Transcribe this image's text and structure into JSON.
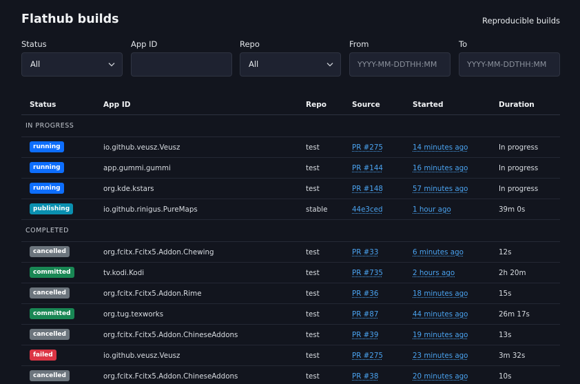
{
  "header": {
    "title": "Flathub builds",
    "top_link": "Reproducible builds"
  },
  "filters": {
    "status": {
      "label": "Status",
      "value": "All"
    },
    "app_id": {
      "label": "App ID",
      "value": ""
    },
    "repo": {
      "label": "Repo",
      "value": "All"
    },
    "from": {
      "label": "From",
      "placeholder": "YYYY-MM-DDTHH:MM"
    },
    "to": {
      "label": "To",
      "placeholder": "YYYY-MM-DDTHH:MM"
    }
  },
  "table": {
    "columns": [
      "Status",
      "App ID",
      "Repo",
      "Source",
      "Started",
      "Duration"
    ],
    "groups": [
      {
        "title": "IN PROGRESS",
        "rows": [
          {
            "status": "running",
            "app_id": "io.github.veusz.Veusz",
            "repo": "test",
            "source": "PR #275",
            "started": "14 minutes ago",
            "duration": "In progress"
          },
          {
            "status": "running",
            "app_id": "app.gummi.gummi",
            "repo": "test",
            "source": "PR #144",
            "started": "16 minutes ago",
            "duration": "In progress"
          },
          {
            "status": "running",
            "app_id": "org.kde.kstars",
            "repo": "test",
            "source": "PR #148",
            "started": "57 minutes ago",
            "duration": "In progress"
          },
          {
            "status": "publishing",
            "app_id": "io.github.rinigus.PureMaps",
            "repo": "stable",
            "source": "44e3ced",
            "started": "1 hour ago",
            "duration": "39m 0s"
          }
        ]
      },
      {
        "title": "COMPLETED",
        "rows": [
          {
            "status": "cancelled",
            "app_id": "org.fcitx.Fcitx5.Addon.Chewing",
            "repo": "test",
            "source": "PR #33",
            "started": "6 minutes ago",
            "duration": "12s"
          },
          {
            "status": "committed",
            "app_id": "tv.kodi.Kodi",
            "repo": "test",
            "source": "PR #735",
            "started": "2 hours ago",
            "duration": "2h 20m"
          },
          {
            "status": "cancelled",
            "app_id": "org.fcitx.Fcitx5.Addon.Rime",
            "repo": "test",
            "source": "PR #36",
            "started": "18 minutes ago",
            "duration": "15s"
          },
          {
            "status": "committed",
            "app_id": "org.tug.texworks",
            "repo": "test",
            "source": "PR #87",
            "started": "44 minutes ago",
            "duration": "26m 17s"
          },
          {
            "status": "cancelled",
            "app_id": "org.fcitx.Fcitx5.Addon.ChineseAddons",
            "repo": "test",
            "source": "PR #39",
            "started": "19 minutes ago",
            "duration": "13s"
          },
          {
            "status": "failed",
            "app_id": "io.github.veusz.Veusz",
            "repo": "test",
            "source": "PR #275",
            "started": "23 minutes ago",
            "duration": "3m 32s"
          },
          {
            "status": "cancelled",
            "app_id": "org.fcitx.Fcitx5.Addon.ChineseAddons",
            "repo": "test",
            "source": "PR #38",
            "started": "20 minutes ago",
            "duration": "10s"
          }
        ]
      }
    ]
  },
  "colors": {
    "background": "#12151e",
    "running": "#0d6efd",
    "publishing": "#0a90b0",
    "cancelled": "#6c757d",
    "committed": "#198754",
    "failed": "#dc3545",
    "link": "#4aa3f0"
  }
}
